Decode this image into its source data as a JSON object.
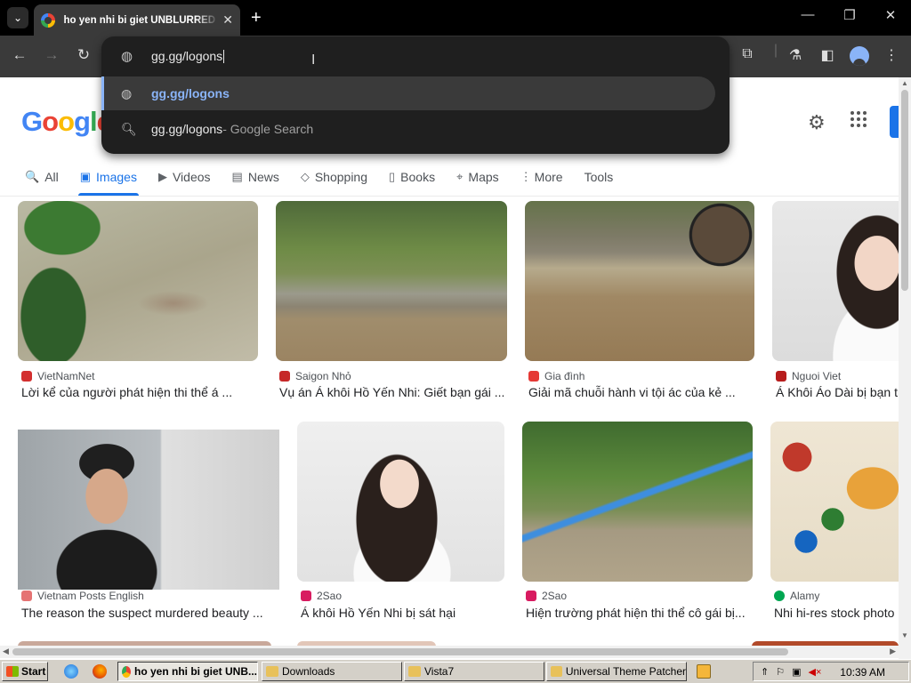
{
  "browser": {
    "tab_title": "ho yen nhi bi giet UNBLURRED - Google Search",
    "tab_close": "✕",
    "new_tab": "+",
    "tab_list": "⌄",
    "minimize": "—",
    "maximize": "❐",
    "close": "✕",
    "back": "←",
    "forward": "→",
    "reload": "↻"
  },
  "omnibox": {
    "value": "gg.gg/logons",
    "suggestions": [
      {
        "text": "gg.gg/logons",
        "suffix": "",
        "icon": "globe-icon"
      },
      {
        "text": "gg.gg/logons",
        "suffix": " - Google Search",
        "icon": "search-icon"
      }
    ]
  },
  "google": {
    "logo_letters": [
      "G",
      "o",
      "o",
      "g",
      "l",
      "e"
    ],
    "logo_colors": [
      "#4285f4",
      "#ea4335",
      "#fbbc05",
      "#4285f4",
      "#34a853",
      "#ea4335"
    ],
    "tabs": [
      {
        "label": "All",
        "icon": "🔍"
      },
      {
        "label": "Images",
        "icon": "▣"
      },
      {
        "label": "Videos",
        "icon": "▶"
      },
      {
        "label": "News",
        "icon": "▤"
      },
      {
        "label": "Shopping",
        "icon": "◇"
      },
      {
        "label": "Books",
        "icon": "▯"
      },
      {
        "label": "Maps",
        "icon": "⌖"
      },
      {
        "label": "More",
        "icon": "⋮"
      },
      {
        "label": "Tools",
        "icon": ""
      }
    ]
  },
  "results": [
    {
      "source": "VietNamNet",
      "caption": "Lời kể của người phát hiện thi thể á ...",
      "fav_color": "#d32f2f"
    },
    {
      "source": "Saigon Nhỏ",
      "caption": "Vụ án Á khôi Hồ Yến Nhi: Giết bạn gái ...",
      "fav_color": "#c62828"
    },
    {
      "source": "Gia đình",
      "caption": "Giải mã chuỗi hành vi tội ác của kẻ ...",
      "fav_color": "#e53935"
    },
    {
      "source": "Nguoi Viet",
      "caption": "Á Khôi Áo Dài bị bạn trai",
      "fav_color": "#b71c1c"
    },
    {
      "source": "Vietnam Posts English",
      "caption": "The reason the suspect murdered beauty ...",
      "fav_color": "#e57373"
    },
    {
      "source": "2Sao",
      "caption": "Á khôi Hồ Yến Nhi bị sát hại",
      "fav_color": "#d81b60"
    },
    {
      "source": "2Sao",
      "caption": "Hiện trường phát hiện thi thể cô gái bị...",
      "fav_color": "#d81b60"
    },
    {
      "source": "Alamy",
      "caption": "Nhi hi-res stock photo",
      "fav_color": "#00a651"
    }
  ],
  "taskbar": {
    "start": "Start",
    "tasks": [
      {
        "label": "ho yen nhi bi giet UNB...",
        "color": "#4285f4"
      },
      {
        "label": "Downloads",
        "color": "#e8c15a"
      },
      {
        "label": "Vista7",
        "color": "#e8c15a"
      },
      {
        "label": "Universal Theme Patcher",
        "color": "#e8c15a"
      }
    ],
    "clock": "10:39 AM"
  }
}
